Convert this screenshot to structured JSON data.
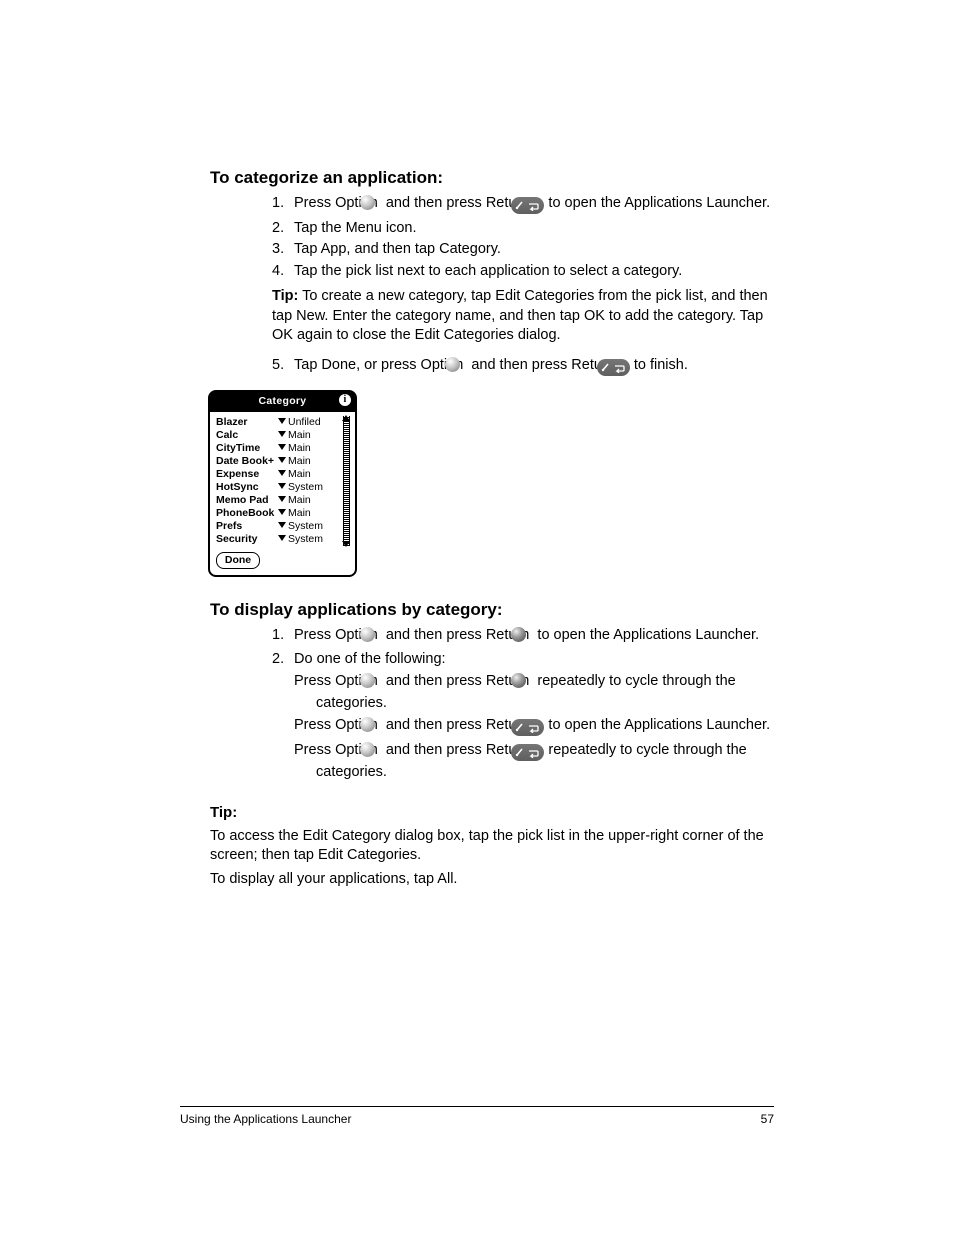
{
  "section1": {
    "title": "To categorize an application:",
    "steps": [
      {
        "n": "1.",
        "pre": "Press Option ",
        "icon_a": "jog",
        "mid": " and then press Return ",
        "icon_b": "pill",
        "post": " to open the Applications Launcher."
      },
      {
        "n": "2.",
        "text": "Tap the Menu icon."
      },
      {
        "n": "3.",
        "text": "Tap App, and then tap Category."
      },
      {
        "n": "4.",
        "text": "Tap the pick list next to each application to select a category."
      }
    ],
    "tip": "To create a new category, tap Edit Categories from the pick list, and then tap New. Enter the category name, and then tap OK to add the category. Tap OK again to close the Edit Categories dialog.",
    "step5": {
      "n": "5.",
      "pre": "Tap Done, or press Option ",
      "icon_a": "jog",
      "mid": " and then press Return ",
      "icon_b": "pill",
      "post": " to finish."
    }
  },
  "screenshot": {
    "title": "Category",
    "apps": [
      "Blazer",
      "Calc",
      "CityTime",
      "Date Book+",
      "Expense",
      "HotSync",
      "Memo Pad",
      "PhoneBook",
      "Prefs",
      "Security"
    ],
    "cats": [
      "Unfiled",
      "Main",
      "Main",
      "Main",
      "Main",
      "System",
      "Main",
      "Main",
      "System",
      "System"
    ],
    "done": "Done"
  },
  "section2": {
    "title": "To display applications by category:",
    "steps": [
      {
        "n": "1.",
        "pre": "Press Option ",
        "icon_a": "jog",
        "mid": " and then press Return ",
        "icon_b": "sphere-dark",
        "post": " to open the Applications Launcher."
      },
      {
        "n": "2.",
        "text": "Do one of the following:"
      },
      {
        "bullet": true,
        "pre": "Press Option ",
        "icon_a": "jog",
        "mid": " and then press Return ",
        "icon_b": "sphere-dark",
        "post": " repeatedly to cycle through the categories."
      },
      {
        "bullet": true,
        "pre": "Press Option ",
        "icon_a": "jog",
        "mid": " and then press Return ",
        "icon_b": "pill",
        "post": " to open the Applications Launcher."
      },
      {
        "bullet": true,
        "pre": "Press Option ",
        "icon_a": "jog",
        "mid": " and then press Return ",
        "icon_b": "pill",
        "post": " repeatedly to cycle through the categories."
      }
    ]
  },
  "tip2": {
    "head": "Tip:",
    "p1": "To access the Edit Category dialog box, tap the pick list in the upper-right corner of the screen; then tap Edit Categories.",
    "p2": "To display all your applications, tap All."
  },
  "footer": {
    "left": "Using the Applications Launcher",
    "right": "57"
  }
}
